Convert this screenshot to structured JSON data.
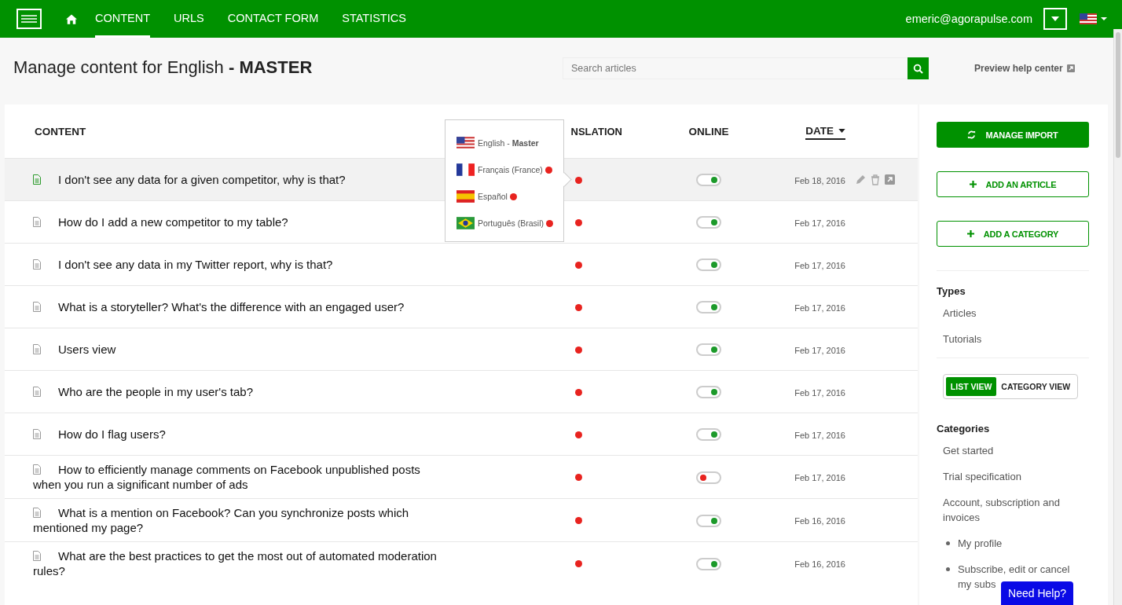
{
  "nav": {
    "tabs": [
      {
        "label": "CONTENT",
        "selected": true
      },
      {
        "label": "URLS",
        "selected": false
      },
      {
        "label": "CONTACT FORM",
        "selected": false
      },
      {
        "label": "STATISTICS",
        "selected": false
      }
    ],
    "user": "emeric@agorapulse.com"
  },
  "header": {
    "title": "Manage content for English",
    "title_bold": "- MASTER",
    "search": {
      "placeholder": "Search articles"
    },
    "preview_link": "Preview help center"
  },
  "table": {
    "columns": [
      "CONTENT",
      "NSLATION",
      "ONLINE",
      "DATE"
    ],
    "rows": [
      {
        "title": "I don't see any data for a given competitor, why is that?",
        "translated": false,
        "online": true,
        "date": "Feb 18, 2016",
        "selected": true
      },
      {
        "title": "How do I add a new competitor to my table?",
        "translated": false,
        "online": true,
        "date": "Feb 17, 2016",
        "selected": false
      },
      {
        "title": "I don't see any data in my Twitter report, why is that?",
        "translated": false,
        "online": true,
        "date": "Feb 17, 2016",
        "selected": false
      },
      {
        "title": "What is a storyteller? What's the difference with an engaged user?",
        "translated": false,
        "online": true,
        "date": "Feb 17, 2016",
        "selected": false
      },
      {
        "title": "Users view",
        "translated": false,
        "online": true,
        "date": "Feb 17, 2016",
        "selected": false
      },
      {
        "title": "Who are the people in my user's tab?",
        "translated": false,
        "online": true,
        "date": "Feb 17, 2016",
        "selected": false
      },
      {
        "title": "How do I flag users?",
        "translated": false,
        "online": true,
        "date": "Feb 17, 2016",
        "selected": false
      },
      {
        "title": "How to efficiently manage comments on Facebook unpublished posts when you run a significant number of ads",
        "translated": false,
        "online": false,
        "date": "Feb 17, 2016",
        "selected": false
      },
      {
        "title": "What is a mention on Facebook? Can you synchronize posts which mentioned my page?",
        "translated": false,
        "online": true,
        "date": "Feb 16, 2016",
        "selected": false
      },
      {
        "title": "What are the best practices to get the most out of automated moderation rules?",
        "translated": false,
        "online": true,
        "date": "Feb 16, 2016",
        "selected": false
      }
    ]
  },
  "language_popup": {
    "items": [
      {
        "kind": "us",
        "label": "English - **Master**",
        "missing_translation": false
      },
      {
        "kind": "fr",
        "label": "Français (France)",
        "missing_translation": true
      },
      {
        "kind": "es",
        "label": "Español",
        "missing_translation": true
      },
      {
        "kind": "br",
        "label": "Português (Brasil)",
        "missing_translation": true
      }
    ]
  },
  "sidebar": {
    "buttons": [
      {
        "kind": "primary",
        "label": "MANAGE IMPORT"
      },
      {
        "kind": "outline",
        "label": "ADD AN ARTICLE"
      },
      {
        "kind": "outline",
        "label": "ADD A CATEGORY"
      }
    ],
    "types_heading": "Types",
    "types": [
      "Articles",
      "Tutorials"
    ],
    "view_toggle": [
      {
        "label": "LIST VIEW",
        "selected": true
      },
      {
        "label": "CATEGORY VIEW",
        "selected": false
      }
    ],
    "categories_heading": "Categories",
    "categories": [
      {
        "label": "Get started"
      },
      {
        "label": "Trial specification"
      },
      {
        "label": "Account, subscription and invoices",
        "children": [
          {
            "label": "My profile"
          },
          {
            "label": "Subscribe, edit or cancel my subs"
          }
        ]
      }
    ]
  },
  "help_button": "Need Help?"
}
